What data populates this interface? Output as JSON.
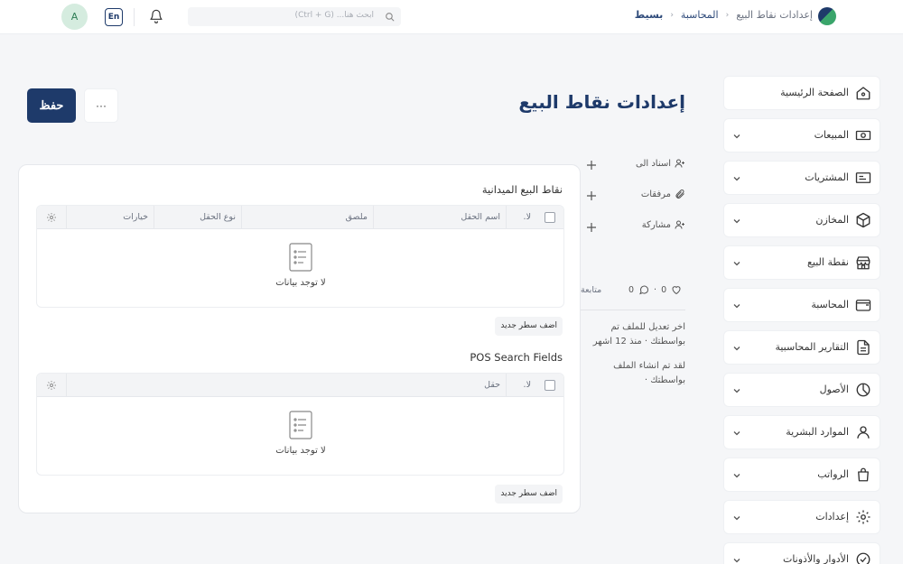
{
  "topbar": {
    "avatar_letter": "A",
    "lang_label": "En",
    "search_placeholder": "ابحث هنا... (Ctrl + G)",
    "breadcrumbs": [
      "بسيط",
      "المحاسبة",
      "إعدادات نقاط البيع"
    ]
  },
  "header": {
    "title": "إعدادات نقاط البيع",
    "save_label": "حفظ",
    "more_label": "···"
  },
  "pos_section": {
    "title": "نقاط البيع الميدانية",
    "columns": [
      "لا.",
      "اسم الحقل",
      "ملصق",
      "نوع الحقل",
      "خيارات"
    ],
    "empty_text": "لا توجد بيانات",
    "add_row_label": "اضف سطر جديد"
  },
  "search_section": {
    "title": "POS Search Fields",
    "columns": [
      "لا.",
      "حقل"
    ],
    "empty_text": "لا توجد بيانات",
    "add_row_label": "اضف سطر جديد"
  },
  "side_panel": {
    "assign_label": "اسناد الى",
    "attachments_label": "مرفقات",
    "share_label": "مشاركة",
    "likes": "0",
    "comments": "0",
    "follow_label": "متابعة",
    "last_edit": "اخر تعديل للملف تم بواسطتك · منذ 12 اشهر",
    "created": "لقد تم انشاء الملف بواسطتك ·"
  },
  "sidebar": {
    "items": [
      {
        "label": "الصفحة الرئيسية",
        "icon": "home-icon"
      },
      {
        "label": "المبيعات",
        "icon": "money-icon"
      },
      {
        "label": "المشتريات",
        "icon": "receipt-icon"
      },
      {
        "label": "المخازن",
        "icon": "box-icon"
      },
      {
        "label": "نقطة البيع",
        "icon": "store-icon"
      },
      {
        "label": "المحاسبة",
        "icon": "wallet-icon"
      },
      {
        "label": "التقارير المحاسبية",
        "icon": "report-icon"
      },
      {
        "label": "الأصول",
        "icon": "assets-icon"
      },
      {
        "label": "الموارد البشرية",
        "icon": "person-icon"
      },
      {
        "label": "الرواتب",
        "icon": "bag-icon"
      },
      {
        "label": "إعدادات",
        "icon": "gear-icon"
      },
      {
        "label": "الأدوار والأذونات",
        "icon": "shield-check-icon"
      }
    ]
  },
  "colors": {
    "primary": "#1e3a6a",
    "accent": "#3aa56b",
    "background": "#f5f6f8"
  }
}
